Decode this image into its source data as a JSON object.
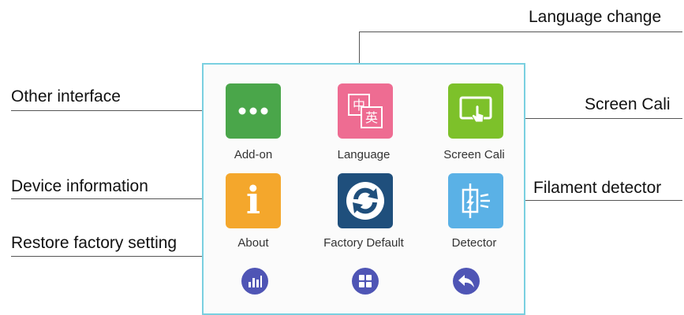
{
  "callouts": {
    "language_change": "Language change",
    "other_interface": "Other interface",
    "screen_cali": "Screen Cali",
    "device_information": "Device information",
    "filament_detector": "Filament detector",
    "restore_factory": "Restore factory setting"
  },
  "tiles": {
    "addon": {
      "label": "Add-on",
      "color": "#4aa64a",
      "icon": "more-dots-icon"
    },
    "language": {
      "label": "Language",
      "color": "#ee6c92",
      "icon": "language-icon",
      "glyph_zh": "中",
      "glyph_en": "英"
    },
    "screencali": {
      "label": "Screen Cali",
      "color": "#7dc12a",
      "icon": "touch-calibration-icon"
    },
    "about": {
      "label": "About",
      "color": "#f4a72c",
      "icon": "info-icon",
      "glyph": "i"
    },
    "factory": {
      "label": "Factory Default",
      "color": "#1f4f7c",
      "icon": "refresh-icon"
    },
    "detector": {
      "label": "Detector",
      "color": "#5ab1e6",
      "icon": "filament-detector-icon"
    }
  },
  "nav": {
    "items": [
      "stats-icon",
      "grid-icon",
      "back-icon"
    ],
    "color": "#4f55b5"
  }
}
